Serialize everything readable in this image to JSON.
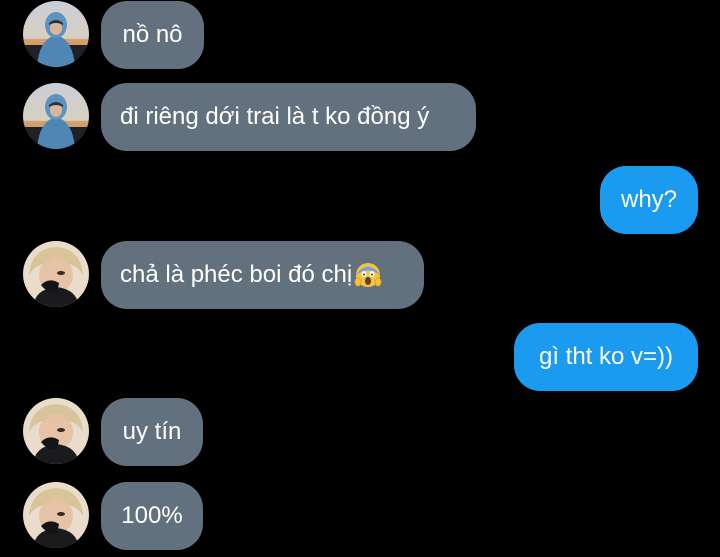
{
  "conversation": {
    "messages": [
      {
        "sender": "them",
        "avatar": "avatar-blue-hoodie",
        "text": "nồ nô"
      },
      {
        "sender": "them",
        "avatar": "avatar-blue-hoodie",
        "text": "đi riêng dới trai là t ko đồng ý"
      },
      {
        "sender": "me",
        "text": "why?"
      },
      {
        "sender": "them",
        "avatar": "avatar-blonde-hair",
        "text": "chả là phéc boi đó chị",
        "emoji": "face-screaming-in-fear-emoji"
      },
      {
        "sender": "me",
        "text": "gì tht ko v=))"
      },
      {
        "sender": "them",
        "avatar": "avatar-blonde-hair",
        "text": "uy tín"
      },
      {
        "sender": "them",
        "avatar": "avatar-blonde-hair",
        "text": "100%"
      }
    ]
  },
  "colors": {
    "background": "#000000",
    "incoming_bubble": "#63717f",
    "outgoing_bubble": "#1a9bf0",
    "text": "#ffffff"
  }
}
